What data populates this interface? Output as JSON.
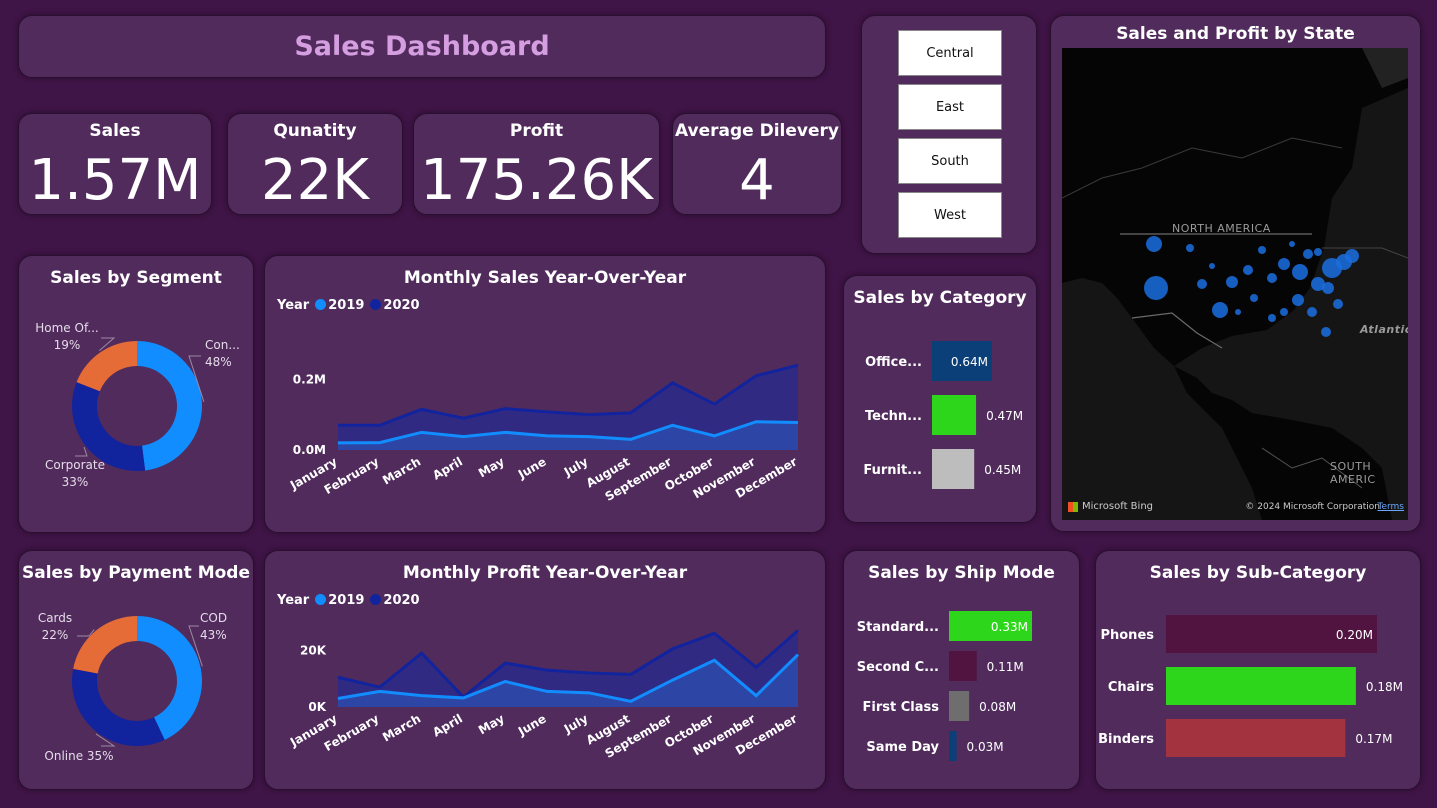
{
  "dashboard": {
    "title": "Sales Dashboard"
  },
  "kpis": [
    {
      "label": "Sales",
      "value": "1.57M"
    },
    {
      "label": "Qunatity",
      "value": "22K"
    },
    {
      "label": "Profit",
      "value": "175.26K"
    },
    {
      "label": "Average Dilevery",
      "value": "4"
    }
  ],
  "region_slicer": {
    "options": [
      "Central",
      "East",
      "South",
      "West"
    ]
  },
  "map": {
    "title": "Sales and Profit by State",
    "labels": {
      "north_america": "NORTH AMERICA",
      "south_america": "SOUTH AMERIC",
      "atlantic": "Atlantic"
    },
    "attribution": {
      "bing": "Microsoft Bing",
      "copyright": "© 2024 Microsoft Corporation",
      "terms": "Terms"
    },
    "bubble_color": "#1a6fe0"
  },
  "colors": {
    "year_2019": "#118dff",
    "year_2020": "#12239e",
    "orange": "#e66c37",
    "green": "#2ed61b",
    "navy_bar": "#0b3f78",
    "gray_bar": "#bdbdbd",
    "maroon": "#51133f",
    "dark_gray": "#6e6e6e",
    "red_bar": "#a3343f"
  },
  "chart_data": [
    {
      "id": "segment",
      "type": "pie",
      "title": "Sales by Segment",
      "slices": [
        {
          "label": "Con...",
          "percent_label": "48%",
          "value": 48,
          "color": "#118dff"
        },
        {
          "label": "Corporate",
          "percent_label": "33%",
          "value": 33,
          "color": "#12239e"
        },
        {
          "label": "Home Of...",
          "percent_label": "19%",
          "value": 19,
          "color": "#e66c37"
        }
      ]
    },
    {
      "id": "payment",
      "type": "pie",
      "title": "Sales by Payment Mode",
      "slices": [
        {
          "label": "COD",
          "percent_label": "43%",
          "value": 43,
          "color": "#118dff"
        },
        {
          "label": "Online 35%",
          "percent_label": "",
          "value": 35,
          "color": "#12239e"
        },
        {
          "label": "Cards",
          "percent_label": "22%",
          "value": 22,
          "color": "#e66c37"
        }
      ]
    },
    {
      "id": "monthly_sales",
      "type": "area",
      "title": "Monthly Sales Year-Over-Year",
      "legend_title": "Year",
      "categories": [
        "January",
        "February",
        "March",
        "April",
        "May",
        "June",
        "July",
        "August",
        "September",
        "October",
        "November",
        "December"
      ],
      "series": [
        {
          "name": "2019",
          "color": "#118dff",
          "values": [
            0.02,
            0.021,
            0.05,
            0.038,
            0.05,
            0.04,
            0.038,
            0.03,
            0.07,
            0.04,
            0.08,
            0.078
          ]
        },
        {
          "name": "2020",
          "color": "#12239e",
          "values": [
            0.07,
            0.07,
            0.115,
            0.09,
            0.117,
            0.108,
            0.1,
            0.105,
            0.19,
            0.13,
            0.21,
            0.24
          ]
        }
      ],
      "ylim": [
        0,
        0.3
      ],
      "yticks": [
        {
          "value": 0,
          "label": "0.0M"
        },
        {
          "value": 0.2,
          "label": "0.2M"
        }
      ]
    },
    {
      "id": "monthly_profit",
      "type": "area",
      "title": "Monthly Profit Year-Over-Year",
      "legend_title": "Year",
      "categories": [
        "January",
        "February",
        "March",
        "April",
        "May",
        "June",
        "July",
        "August",
        "September",
        "October",
        "November",
        "December"
      ],
      "series": [
        {
          "name": "2019",
          "color": "#118dff",
          "values": [
            3000,
            5500,
            4000,
            3200,
            9000,
            5500,
            5000,
            2000,
            9500,
            16500,
            4000,
            18500
          ]
        },
        {
          "name": "2020",
          "color": "#12239e",
          "values": [
            10500,
            7000,
            19000,
            3500,
            15500,
            13000,
            12000,
            11500,
            20500,
            26000,
            14000,
            27000
          ]
        }
      ],
      "ylim": [
        0,
        30000
      ],
      "yticks": [
        {
          "value": 0,
          "label": "0K"
        },
        {
          "value": 20000,
          "label": "20K"
        }
      ]
    },
    {
      "id": "category",
      "type": "bar",
      "title": "Sales by Category",
      "categories": [
        "Office...",
        "Techn...",
        "Furnit..."
      ],
      "values": [
        0.64,
        0.47,
        0.45
      ],
      "value_labels": [
        "0.64M",
        "0.47M",
        "0.45M"
      ],
      "colors": [
        "#0b3f78",
        "#2ed61b",
        "#bdbdbd"
      ],
      "xlim": [
        0,
        0.64
      ]
    },
    {
      "id": "ship_mode",
      "type": "bar",
      "title": "Sales by Ship Mode",
      "categories": [
        "Standard...",
        "Second C...",
        "First Class",
        "Same Day"
      ],
      "values": [
        0.33,
        0.11,
        0.08,
        0.03
      ],
      "value_labels": [
        "0.33M",
        "0.11M",
        "0.08M",
        "0.03M"
      ],
      "colors": [
        "#2ed61b",
        "#51133f",
        "#6e6e6e",
        "#0b3f78"
      ],
      "xlim": [
        0,
        0.33
      ]
    },
    {
      "id": "sub_category",
      "type": "bar",
      "title": "Sales by Sub-Category",
      "categories": [
        "Phones",
        "Chairs",
        "Binders"
      ],
      "values": [
        0.2,
        0.18,
        0.17
      ],
      "value_labels": [
        "0.20M",
        "0.18M",
        "0.17M"
      ],
      "colors": [
        "#51133f",
        "#2ed61b",
        "#a3343f"
      ],
      "xlim": [
        0,
        0.2
      ]
    }
  ]
}
